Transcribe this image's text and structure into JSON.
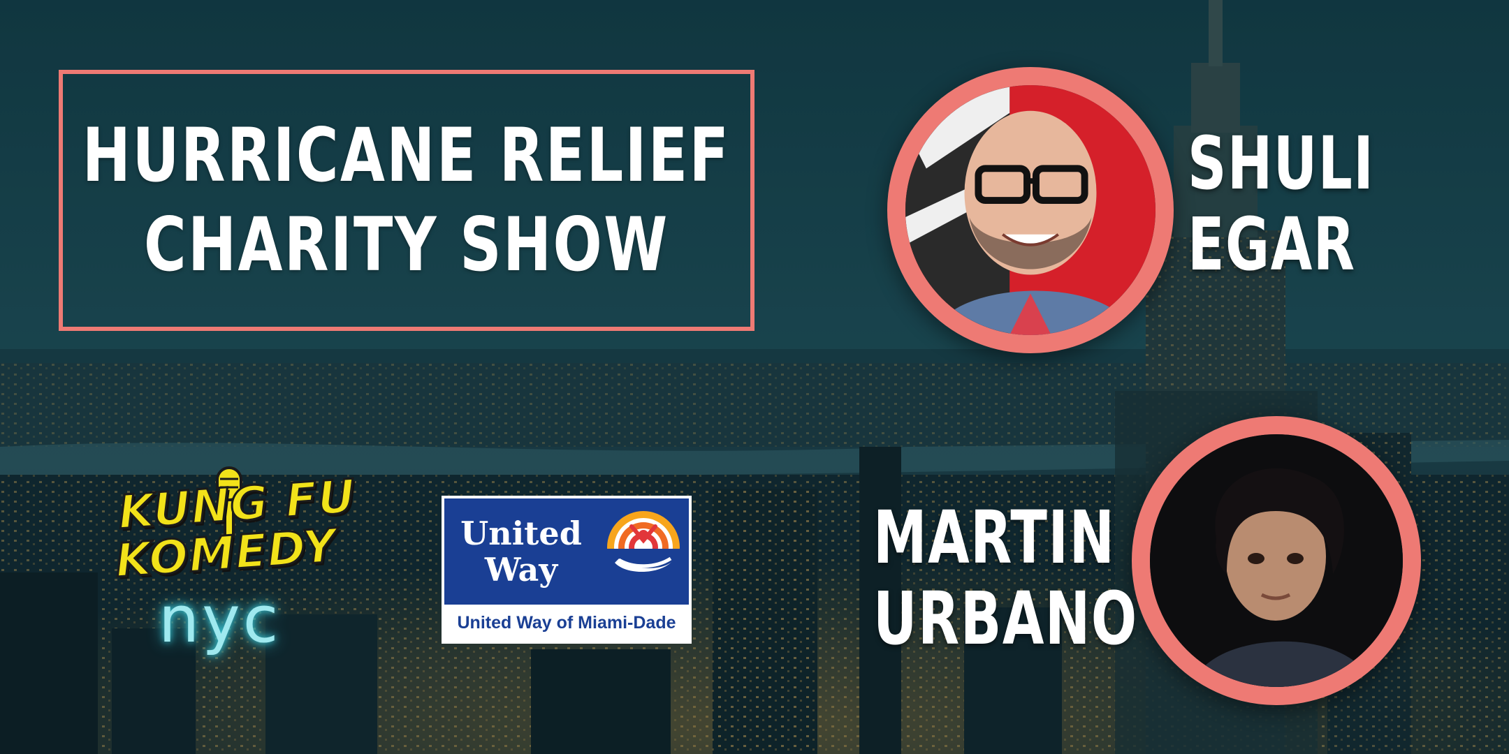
{
  "title": {
    "line1": "HURRICANE RELIEF",
    "line2": "CHARITY SHOW"
  },
  "performers": [
    {
      "first": "SHULI",
      "last": "EGAR"
    },
    {
      "first": "MARTIN",
      "last": "URBANO"
    }
  ],
  "logos": {
    "kungfu": {
      "line1": "KUNG FU",
      "line2": "KOMEDY",
      "city": "nyc"
    },
    "united_way": {
      "word1": "United",
      "word2": "Way",
      "caption": "United Way of Miami-Dade"
    }
  },
  "colors": {
    "accent": "#ee7a74",
    "text": "#ffffff",
    "kungfu_yellow": "#f2e21a",
    "neon_cyan": "#9fe9ef",
    "united_way_blue": "#1a3f94"
  }
}
